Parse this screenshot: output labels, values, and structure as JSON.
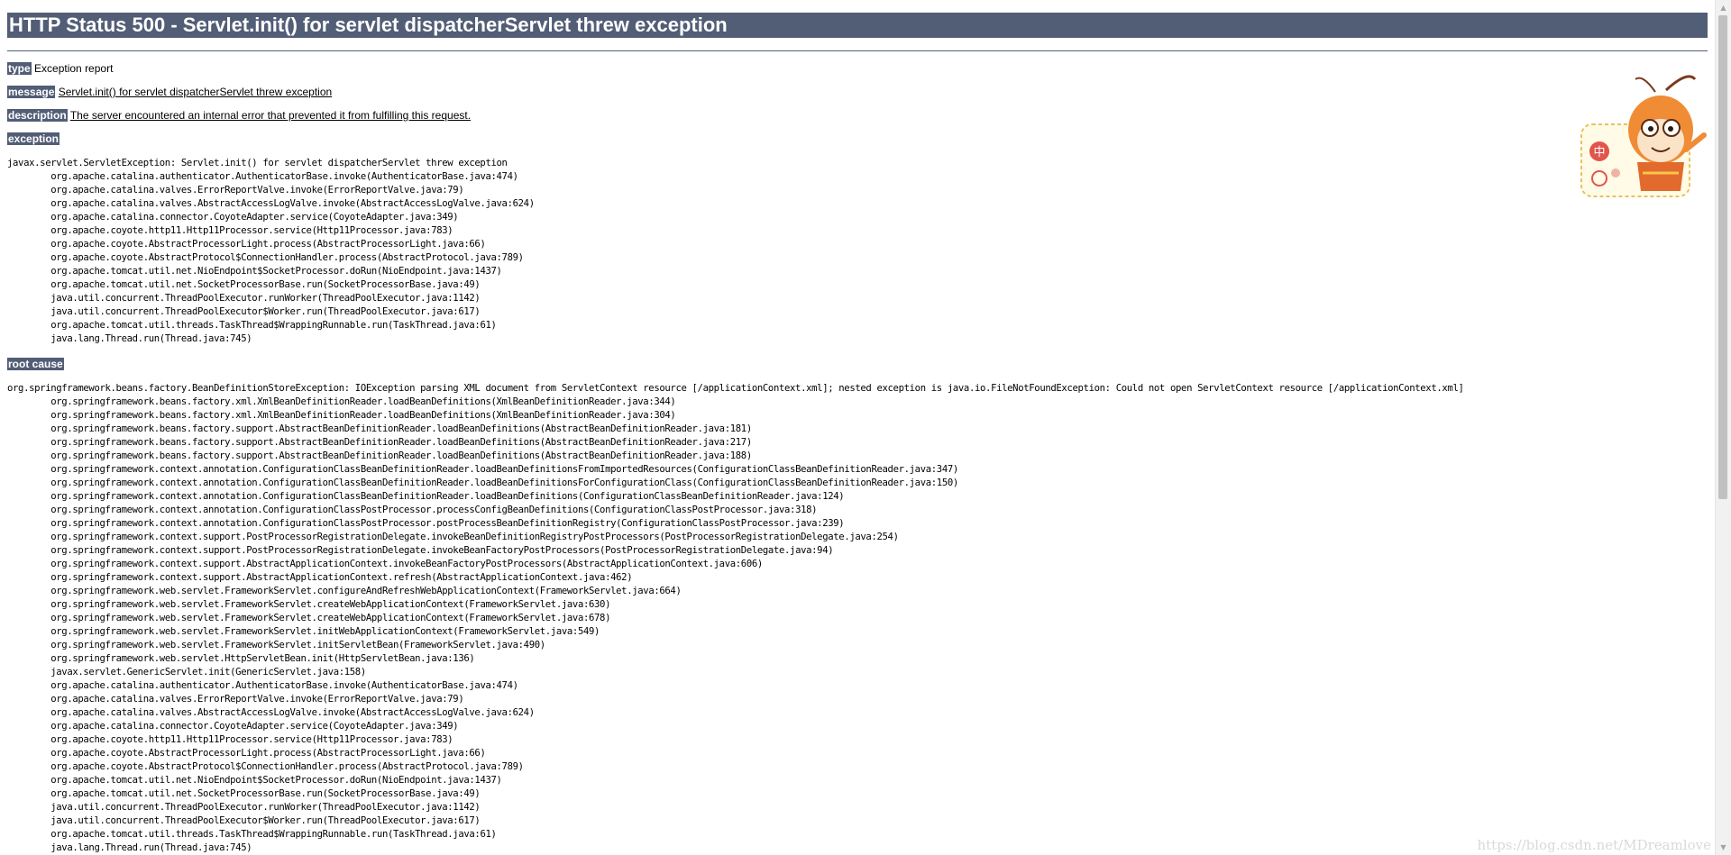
{
  "title": "HTTP Status 500 - Servlet.init() for servlet dispatcherServlet threw exception",
  "report": {
    "type_label": "type",
    "type_value": "Exception report",
    "message_label": "message",
    "message_value": "Servlet.init() for servlet dispatcherServlet threw exception",
    "description_label": "description",
    "description_value": "The server encountered an internal error that prevented it from fulfilling this request.",
    "exception_label": "exception",
    "exception_trace": "javax.servlet.ServletException: Servlet.init() for servlet dispatcherServlet threw exception\n\torg.apache.catalina.authenticator.AuthenticatorBase.invoke(AuthenticatorBase.java:474)\n\torg.apache.catalina.valves.ErrorReportValve.invoke(ErrorReportValve.java:79)\n\torg.apache.catalina.valves.AbstractAccessLogValve.invoke(AbstractAccessLogValve.java:624)\n\torg.apache.catalina.connector.CoyoteAdapter.service(CoyoteAdapter.java:349)\n\torg.apache.coyote.http11.Http11Processor.service(Http11Processor.java:783)\n\torg.apache.coyote.AbstractProcessorLight.process(AbstractProcessorLight.java:66)\n\torg.apache.coyote.AbstractProtocol$ConnectionHandler.process(AbstractProtocol.java:789)\n\torg.apache.tomcat.util.net.NioEndpoint$SocketProcessor.doRun(NioEndpoint.java:1437)\n\torg.apache.tomcat.util.net.SocketProcessorBase.run(SocketProcessorBase.java:49)\n\tjava.util.concurrent.ThreadPoolExecutor.runWorker(ThreadPoolExecutor.java:1142)\n\tjava.util.concurrent.ThreadPoolExecutor$Worker.run(ThreadPoolExecutor.java:617)\n\torg.apache.tomcat.util.threads.TaskThread$WrappingRunnable.run(TaskThread.java:61)\n\tjava.lang.Thread.run(Thread.java:745)",
    "root_cause_label": "root cause",
    "root_cause_trace": "org.springframework.beans.factory.BeanDefinitionStoreException: IOException parsing XML document from ServletContext resource [/applicationContext.xml]; nested exception is java.io.FileNotFoundException: Could not open ServletContext resource [/applicationContext.xml]\n\torg.springframework.beans.factory.xml.XmlBeanDefinitionReader.loadBeanDefinitions(XmlBeanDefinitionReader.java:344)\n\torg.springframework.beans.factory.xml.XmlBeanDefinitionReader.loadBeanDefinitions(XmlBeanDefinitionReader.java:304)\n\torg.springframework.beans.factory.support.AbstractBeanDefinitionReader.loadBeanDefinitions(AbstractBeanDefinitionReader.java:181)\n\torg.springframework.beans.factory.support.AbstractBeanDefinitionReader.loadBeanDefinitions(AbstractBeanDefinitionReader.java:217)\n\torg.springframework.beans.factory.support.AbstractBeanDefinitionReader.loadBeanDefinitions(AbstractBeanDefinitionReader.java:188)\n\torg.springframework.context.annotation.ConfigurationClassBeanDefinitionReader.loadBeanDefinitionsFromImportedResources(ConfigurationClassBeanDefinitionReader.java:347)\n\torg.springframework.context.annotation.ConfigurationClassBeanDefinitionReader.loadBeanDefinitionsForConfigurationClass(ConfigurationClassBeanDefinitionReader.java:150)\n\torg.springframework.context.annotation.ConfigurationClassBeanDefinitionReader.loadBeanDefinitions(ConfigurationClassBeanDefinitionReader.java:124)\n\torg.springframework.context.annotation.ConfigurationClassPostProcessor.processConfigBeanDefinitions(ConfigurationClassPostProcessor.java:318)\n\torg.springframework.context.annotation.ConfigurationClassPostProcessor.postProcessBeanDefinitionRegistry(ConfigurationClassPostProcessor.java:239)\n\torg.springframework.context.support.PostProcessorRegistrationDelegate.invokeBeanDefinitionRegistryPostProcessors(PostProcessorRegistrationDelegate.java:254)\n\torg.springframework.context.support.PostProcessorRegistrationDelegate.invokeBeanFactoryPostProcessors(PostProcessorRegistrationDelegate.java:94)\n\torg.springframework.context.support.AbstractApplicationContext.invokeBeanFactoryPostProcessors(AbstractApplicationContext.java:606)\n\torg.springframework.context.support.AbstractApplicationContext.refresh(AbstractApplicationContext.java:462)\n\torg.springframework.web.servlet.FrameworkServlet.configureAndRefreshWebApplicationContext(FrameworkServlet.java:664)\n\torg.springframework.web.servlet.FrameworkServlet.createWebApplicationContext(FrameworkServlet.java:630)\n\torg.springframework.web.servlet.FrameworkServlet.createWebApplicationContext(FrameworkServlet.java:678)\n\torg.springframework.web.servlet.FrameworkServlet.initWebApplicationContext(FrameworkServlet.java:549)\n\torg.springframework.web.servlet.FrameworkServlet.initServletBean(FrameworkServlet.java:490)\n\torg.springframework.web.servlet.HttpServletBean.init(HttpServletBean.java:136)\n\tjavax.servlet.GenericServlet.init(GenericServlet.java:158)\n\torg.apache.catalina.authenticator.AuthenticatorBase.invoke(AuthenticatorBase.java:474)\n\torg.apache.catalina.valves.ErrorReportValve.invoke(ErrorReportValve.java:79)\n\torg.apache.catalina.valves.AbstractAccessLogValve.invoke(AbstractAccessLogValve.java:624)\n\torg.apache.catalina.connector.CoyoteAdapter.service(CoyoteAdapter.java:349)\n\torg.apache.coyote.http11.Http11Processor.service(Http11Processor.java:783)\n\torg.apache.coyote.AbstractProcessorLight.process(AbstractProcessorLight.java:66)\n\torg.apache.coyote.AbstractProtocol$ConnectionHandler.process(AbstractProtocol.java:789)\n\torg.apache.tomcat.util.net.NioEndpoint$SocketProcessor.doRun(NioEndpoint.java:1437)\n\torg.apache.tomcat.util.net.SocketProcessorBase.run(SocketProcessorBase.java:49)\n\tjava.util.concurrent.ThreadPoolExecutor.runWorker(ThreadPoolExecutor.java:1142)\n\tjava.util.concurrent.ThreadPoolExecutor$Worker.run(ThreadPoolExecutor.java:617)\n\torg.apache.tomcat.util.threads.TaskThread$WrappingRunnable.run(TaskThread.java:61)\n\tjava.lang.Thread.run(Thread.java:745)"
  },
  "watermark": "https://blog.csdn.net/MDreamlove",
  "colors": {
    "header_bg": "#525d76",
    "header_text": "#ffffff",
    "body_bg": "#ffffff"
  },
  "icons": {
    "mascot": "cartoon-monkey-mascot-icon"
  }
}
